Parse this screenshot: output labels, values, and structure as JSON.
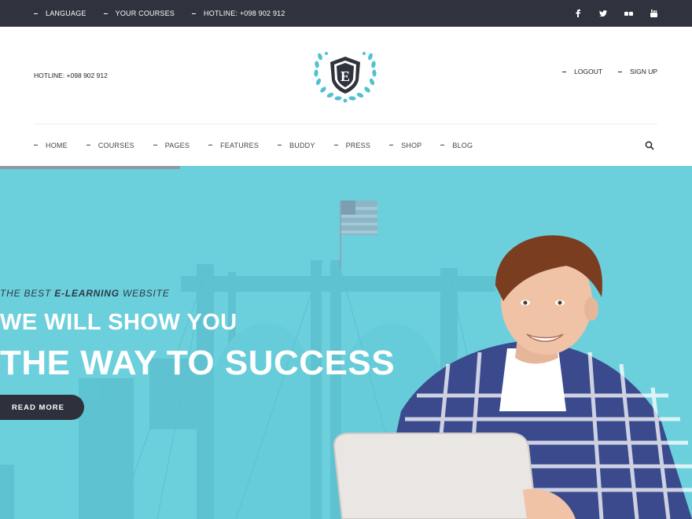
{
  "topbar": {
    "links": [
      "LANGUAGE",
      "YOUR COURSES",
      "HOTLINE: +098 902 912"
    ],
    "social": [
      "facebook-icon",
      "twitter-icon",
      "flickr-icon",
      "youtube-icon"
    ]
  },
  "header": {
    "hotline": "HOTLINE: +098 902 912",
    "logo_letter": "E",
    "logout": "LOGOUT",
    "signup": "SIGN UP"
  },
  "nav": {
    "items": [
      "HOME",
      "COURSES",
      "PAGES",
      "FEATURES",
      "BUDDY",
      "PRESS",
      "SHOP",
      "BLOG"
    ]
  },
  "hero": {
    "kicker_pre": "THE BEST ",
    "kicker_bold": "E-LEARNING",
    "kicker_post": " WEBSITE",
    "headline_1": "WE WILL SHOW YOU",
    "headline_2": "THE WAY TO SUCCESS",
    "cta": "READ MORE",
    "slide_progress": 0.26
  },
  "colors": {
    "topbar": "#30333d",
    "hero_bg": "#6ccfdc",
    "accent": "#4fc1cf",
    "button": "#2e313b"
  }
}
